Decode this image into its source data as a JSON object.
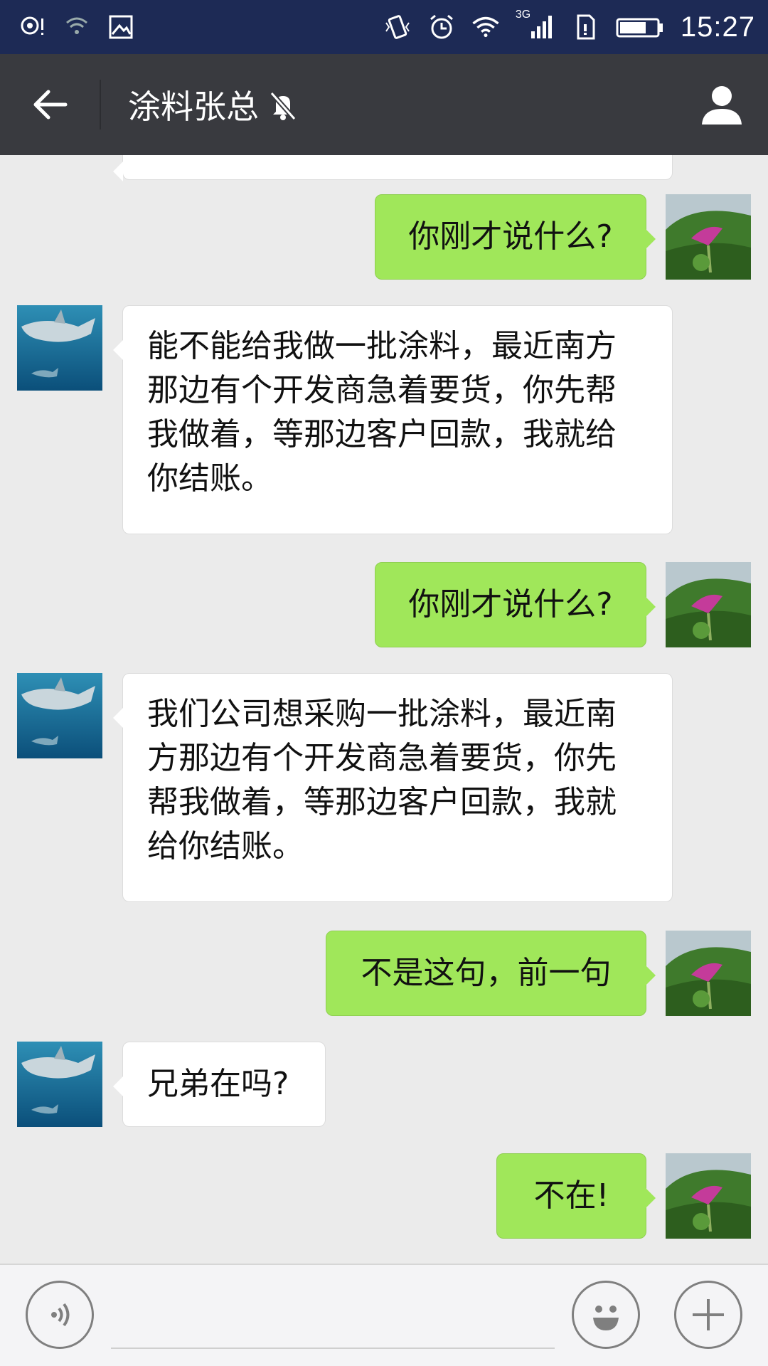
{
  "status_bar": {
    "time": "15:27",
    "network": "3G",
    "icons_left": [
      "location-alert-icon",
      "wifi-hotspot-icon",
      "image-icon"
    ],
    "icons_right": [
      "vibrate-icon",
      "alarm-icon",
      "wifi-icon",
      "signal-icon",
      "sim-icon",
      "battery-icon"
    ]
  },
  "header": {
    "title": "涂料张总",
    "muted": true,
    "icons": [
      "back-arrow-icon",
      "mute-bell-icon",
      "profile-icon"
    ]
  },
  "messages": [
    {
      "id": 1,
      "direction": "outgoing",
      "text": "你刚才说什么?"
    },
    {
      "id": 2,
      "direction": "incoming",
      "lines": [
        "能不能给我做一批涂料，最近南方",
        "那边有个开发商急着要货，你先帮",
        "我做着，等那边客户回款，我就给",
        "你结账。"
      ]
    },
    {
      "id": 3,
      "direction": "outgoing",
      "text": "你刚才说什么?"
    },
    {
      "id": 4,
      "direction": "incoming",
      "lines": [
        "我们公司想采购一批涂料，最近南",
        "方那边有个开发商急着要货，你先",
        "帮我做着，等那边客户回款，我就",
        "给你结账。"
      ]
    },
    {
      "id": 5,
      "direction": "outgoing",
      "text": "不是这句，前一句"
    },
    {
      "id": 6,
      "direction": "incoming",
      "text": "兄弟在吗?"
    },
    {
      "id": 7,
      "direction": "outgoing",
      "text": "不在!"
    }
  ],
  "input_bar": {
    "icons": [
      "voice-input-icon",
      "emoji-icon",
      "add-icon"
    ],
    "text_value": ""
  },
  "colors": {
    "status_bar": "#1d2a55",
    "title_bar": "#393a3f",
    "chat_background": "#ebebeb",
    "outgoing_bubble": "#a0e75a",
    "incoming_bubble": "#ffffff"
  }
}
